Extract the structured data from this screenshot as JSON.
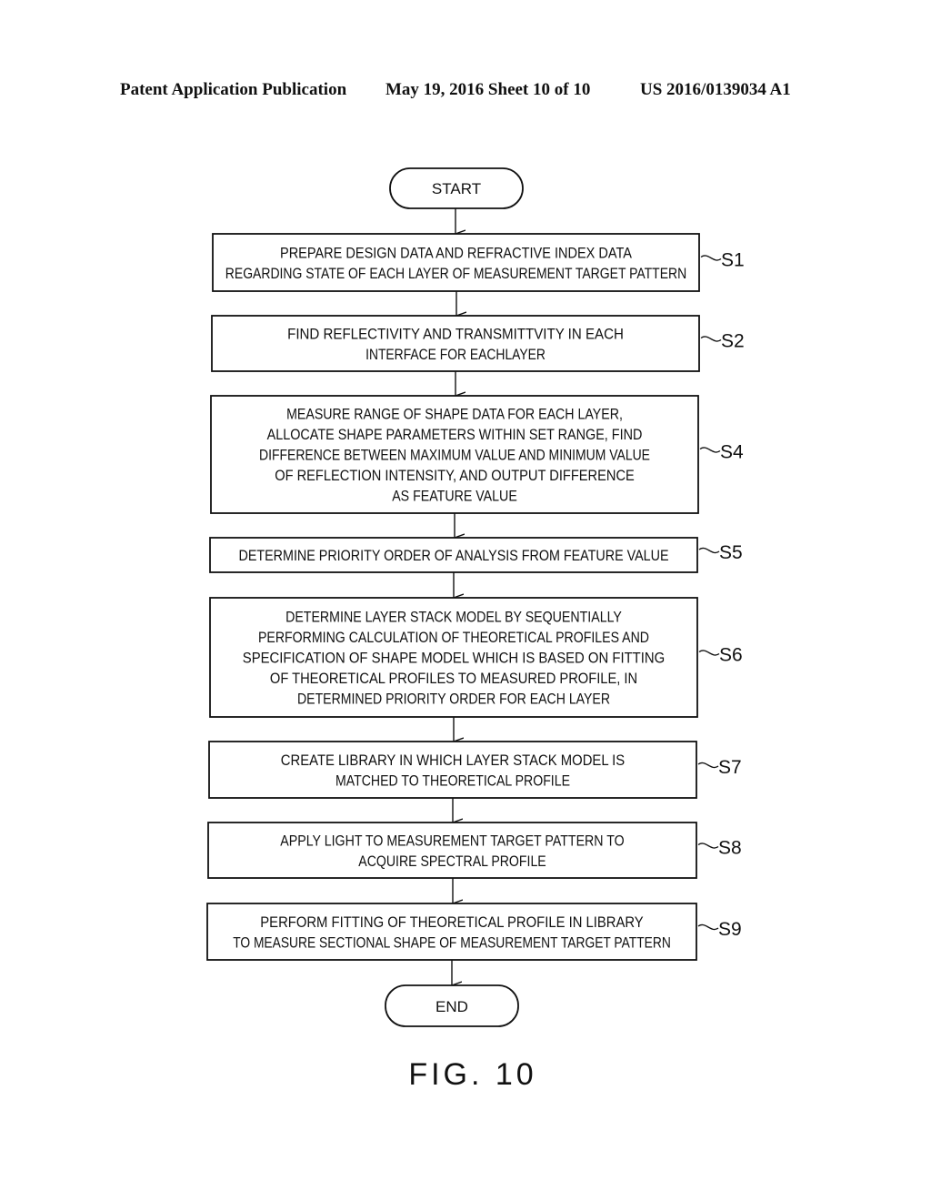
{
  "header": {
    "left": "Patent Application Publication",
    "middle": "May 19, 2016  Sheet 10 of 10",
    "right": "US 2016/0139034 A1"
  },
  "start": "START",
  "end": "END",
  "steps": [
    {
      "id": "S1",
      "label": "S1",
      "lines": [
        "PREPARE DESIGN DATA AND REFRACTIVE INDEX DATA",
        "REGARDING STATE OF EACH LAYER OF MEASUREMENT TARGET PATTERN"
      ]
    },
    {
      "id": "S2",
      "label": "S2",
      "lines": [
        "FIND REFLECTIVITY AND TRANSMITTVITY IN EACH",
        "INTERFACE FOR EACHLAYER"
      ]
    },
    {
      "id": "S4",
      "label": "S4",
      "lines": [
        "MEASURE RANGE OF SHAPE DATA FOR EACH LAYER,",
        "ALLOCATE SHAPE PARAMETERS WITHIN SET RANGE, FIND",
        "DIFFERENCE BETWEEN MAXIMUM VALUE AND MINIMUM VALUE",
        "OF REFLECTION INTENSITY, AND OUTPUT DIFFERENCE",
        "AS FEATURE VALUE"
      ]
    },
    {
      "id": "S5",
      "label": "S5",
      "lines": [
        "DETERMINE PRIORITY ORDER OF ANALYSIS FROM FEATURE VALUE"
      ]
    },
    {
      "id": "S6",
      "label": "S6",
      "lines": [
        "DETERMINE LAYER STACK MODEL BY SEQUENTIALLY",
        "PERFORMING CALCULATION OF THEORETICAL PROFILES AND",
        "SPECIFICATION OF SHAPE MODEL WHICH IS BASED ON FITTING",
        "OF THEORETICAL PROFILES TO MEASURED PROFILE, IN",
        "DETERMINED PRIORITY ORDER FOR EACH LAYER"
      ]
    },
    {
      "id": "S7",
      "label": "S7",
      "lines": [
        "CREATE LIBRARY IN WHICH LAYER STACK MODEL IS",
        "MATCHED TO THEORETICAL PROFILE"
      ]
    },
    {
      "id": "S8",
      "label": "S8",
      "lines": [
        "APPLY LIGHT TO MEASUREMENT TARGET PATTERN TO",
        "ACQUIRE SPECTRAL PROFILE"
      ]
    },
    {
      "id": "S9",
      "label": "S9",
      "lines": [
        "PERFORM FITTING OF THEORETICAL PROFILE IN LIBRARY",
        "TO MEASURE SECTIONAL SHAPE OF MEASUREMENT TARGET PATTERN"
      ]
    }
  ],
  "figure_caption": "FIG. 10"
}
